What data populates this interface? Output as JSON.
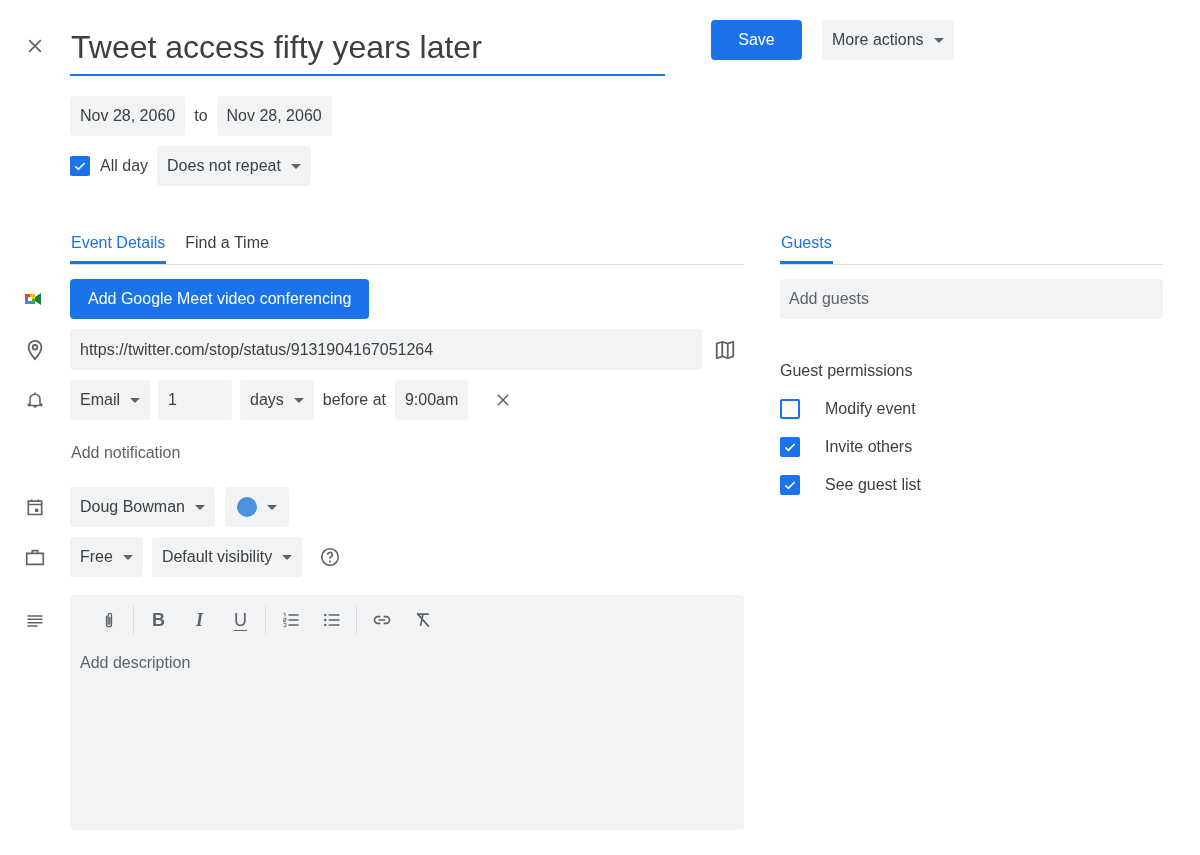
{
  "title": {
    "value": "Tweet access fifty years later"
  },
  "actions": {
    "save": "Save",
    "more": "More actions"
  },
  "dates": {
    "start": "Nov 28, 2060",
    "separator": "to",
    "end": "Nov 28, 2060"
  },
  "all_day": {
    "label": "All day",
    "checked": true
  },
  "repeat": "Does not repeat",
  "tabs": [
    {
      "label": "Event Details",
      "selected": true
    },
    {
      "label": "Find a Time",
      "selected": false
    }
  ],
  "meet_button": "Add Google Meet video conferencing",
  "location": {
    "value": "https://twitter.com/stop/status/9131904167051264"
  },
  "notification": {
    "method": "Email",
    "amount": "1",
    "unit": "days",
    "connector": "before at",
    "time": "9:00am"
  },
  "add_notification": "Add notification",
  "calendar": {
    "owner": "Doug Bowman",
    "color": "#4a93dc"
  },
  "availability": "Free",
  "visibility": "Default visibility",
  "format_buttons": [
    "B",
    "I",
    "U"
  ],
  "description": {
    "placeholder": "Add description"
  },
  "guests_tab": {
    "label": "Guests",
    "selected": true
  },
  "guests_field": {
    "placeholder": "Add guests"
  },
  "permissions": {
    "title": "Guest permissions",
    "items": [
      {
        "label": "Modify event",
        "checked": false
      },
      {
        "label": "Invite others",
        "checked": true
      },
      {
        "label": "See guest list",
        "checked": true
      }
    ]
  }
}
